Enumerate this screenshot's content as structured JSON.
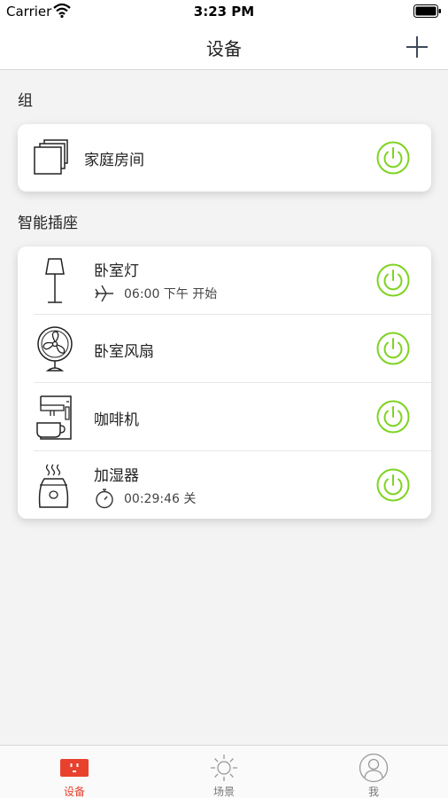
{
  "status_bar": {
    "carrier": "Carrier",
    "time": "3:23 PM"
  },
  "nav": {
    "title": "设备",
    "add_icon": "plus-icon"
  },
  "group_section": {
    "title": "组",
    "items": [
      {
        "name": "家庭房间",
        "icon": "group-stack-icon",
        "power_on": true
      }
    ]
  },
  "socket_section": {
    "title": "智能插座",
    "items": [
      {
        "name": "卧室灯",
        "icon": "floor-lamp-icon",
        "schedule_icon": "airplane-icon",
        "schedule_text": "06:00 下午 开始",
        "power_on": true
      },
      {
        "name": "卧室风扇",
        "icon": "fan-icon",
        "power_on": true
      },
      {
        "name": "咖啡机",
        "icon": "coffee-machine-icon",
        "power_on": true
      },
      {
        "name": "加湿器",
        "icon": "humidifier-icon",
        "timer_icon": "stopwatch-icon",
        "timer_text": "00:29:46 关",
        "power_on": true
      }
    ]
  },
  "tabs": [
    {
      "label": "设备",
      "icon": "socket-icon",
      "active": true
    },
    {
      "label": "场景",
      "icon": "sun-icon",
      "active": false
    },
    {
      "label": "我",
      "icon": "user-icon",
      "active": false
    }
  ],
  "colors": {
    "accent_green": "#7ed321",
    "active_tab_red": "#e8412e"
  }
}
